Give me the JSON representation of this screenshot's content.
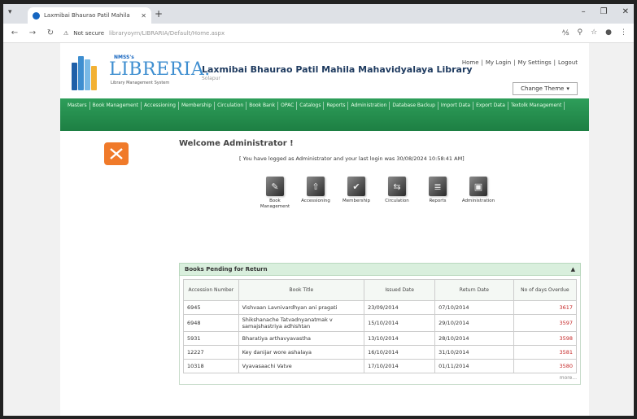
{
  "browser": {
    "tab_title": "Laxmibai Bhaurao Patil Mahila",
    "url_warning": "Not secure",
    "url": "libraryoyrn/LIBRARIA/Default/Home.aspx"
  },
  "header": {
    "brand_small": "NMSS's",
    "brand": "LIBRERIA.",
    "tagline": "Library Management System",
    "library_name": "Laxmibai Bhaurao Patil Mahila Mahavidyalaya Library",
    "library_sub": "Solapur",
    "links": [
      "Home",
      "My Login",
      "My Settings",
      "Logout"
    ],
    "link_sep": "|",
    "theme_button": "Change Theme"
  },
  "menu": [
    "Masters",
    "Book Management",
    "Accessioning",
    "Membership",
    "Circulation",
    "Book Bank",
    "OPAC",
    "Catalogs",
    "Reports",
    "Administration",
    "Database Backup",
    "Import Data",
    "Export Data",
    "Textolk Management"
  ],
  "welcome": "Welcome Administrator !",
  "last_login": "[ You have logged as Administrator and your last login was 30/08/2024 10:58:41 AM]",
  "quick_links": [
    {
      "label": "Book Management",
      "icon": "book-management-icon",
      "glyph": "✎"
    },
    {
      "label": "Accessioning",
      "icon": "accessioning-icon",
      "glyph": "⇧"
    },
    {
      "label": "Membership",
      "icon": "membership-icon",
      "glyph": "✔"
    },
    {
      "label": "Circulation",
      "icon": "circulation-icon",
      "glyph": "⇆"
    },
    {
      "label": "Reports",
      "icon": "reports-icon",
      "glyph": "≣"
    },
    {
      "label": "Administration",
      "icon": "administration-icon",
      "glyph": "▣"
    }
  ],
  "pending": {
    "title": "Books Pending for Return",
    "columns": [
      "Accession Number",
      "Book Title",
      "Issued Date",
      "Return Date",
      "No of days Overdue"
    ],
    "rows": [
      [
        "6945",
        "Vishvaan Lavnivardhyan ani pragati",
        "23/09/2014",
        "07/10/2014",
        "3617"
      ],
      [
        "6948",
        "Shikshanache Tatvadnyanatmak v samajshastriya adhishtan",
        "15/10/2014",
        "29/10/2014",
        "3597"
      ],
      [
        "5931",
        "Bharatiya arthavyavastha",
        "13/10/2014",
        "28/10/2014",
        "3598"
      ],
      [
        "12227",
        "Key danijar wore ashalaya",
        "16/10/2014",
        "31/10/2014",
        "3581"
      ],
      [
        "10318",
        "Vyavasaachi Vatve",
        "17/10/2014",
        "01/11/2014",
        "3580"
      ]
    ],
    "more": "more..."
  },
  "colors": {
    "menu_green": "#2e9e5a",
    "overdue_red": "#c62828",
    "brand_blue": "#3e8ed0",
    "orange_logo": "#f07a2a"
  }
}
